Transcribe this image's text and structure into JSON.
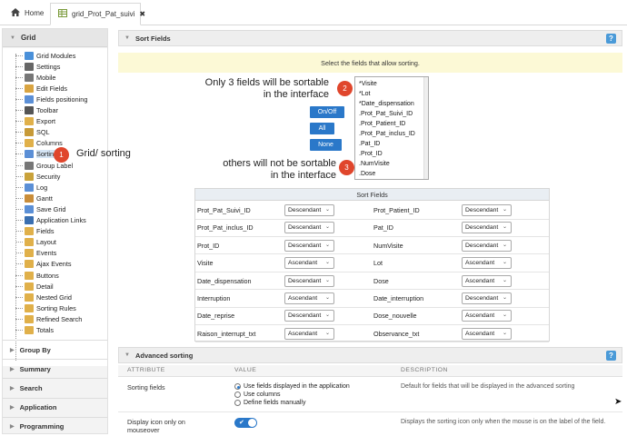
{
  "topbar": {
    "home_label": "Home",
    "grid_tab_label": "grid_Prot_Pat_suivi",
    "close_glyph": "✖"
  },
  "sidebar": {
    "header": "Grid",
    "items": [
      {
        "label": "Grid Modules",
        "icon": "modules-icon",
        "color": "#4a90d9"
      },
      {
        "label": "Settings",
        "icon": "gear-icon",
        "color": "#666666"
      },
      {
        "label": "Mobile",
        "icon": "mobile-icon",
        "color": "#777777"
      },
      {
        "label": "Edit Fields",
        "icon": "edit-icon",
        "color": "#d9a441"
      },
      {
        "label": "Fields positioning",
        "icon": "move-icon",
        "color": "#5b8fd6"
      },
      {
        "label": "Toolbar",
        "icon": "wrench-icon",
        "color": "#555555"
      },
      {
        "label": "Export",
        "icon": "folder-icon",
        "color": "#e0b04a"
      },
      {
        "label": "SQL",
        "icon": "database-icon",
        "color": "#c79a38"
      },
      {
        "label": "Columns",
        "icon": "folder-icon",
        "color": "#e0b04a"
      },
      {
        "label": "Sorting",
        "icon": "sort-icon",
        "color": "#5b8fd6"
      },
      {
        "label": "Group Label",
        "icon": "group-icon",
        "color": "#777777"
      },
      {
        "label": "Security",
        "icon": "lock-icon",
        "color": "#c9a23a"
      },
      {
        "label": "Log",
        "icon": "log-icon",
        "color": "#5b8fd6"
      },
      {
        "label": "Gantt",
        "icon": "gantt-icon",
        "color": "#c98d3a"
      },
      {
        "label": "Save Grid",
        "icon": "save-icon",
        "color": "#5b8fd6"
      },
      {
        "label": "Application Links",
        "icon": "link-icon",
        "color": "#3a6fb0"
      },
      {
        "label": "Fields",
        "icon": "folder-icon",
        "color": "#e0b04a"
      },
      {
        "label": "Layout",
        "icon": "folder-icon",
        "color": "#e0b04a"
      },
      {
        "label": "Events",
        "icon": "folder-icon",
        "color": "#e0b04a"
      },
      {
        "label": "Ajax Events",
        "icon": "folder-icon",
        "color": "#e0b04a"
      },
      {
        "label": "Buttons",
        "icon": "folder-icon",
        "color": "#e0b04a"
      },
      {
        "label": "Detail",
        "icon": "folder-icon",
        "color": "#e0b04a"
      },
      {
        "label": "Nested Grid",
        "icon": "folder-icon",
        "color": "#e0b04a"
      },
      {
        "label": "Sorting Rules",
        "icon": "folder-icon",
        "color": "#e0b04a"
      },
      {
        "label": "Refined Search",
        "icon": "folder-icon",
        "color": "#e0b04a"
      },
      {
        "label": "Totals",
        "icon": "folder-icon",
        "color": "#e0b04a"
      }
    ],
    "sections": [
      "Group By",
      "Summary",
      "Search",
      "Application",
      "Programming"
    ]
  },
  "main": {
    "sort_fields_title": "Sort Fields",
    "help_glyph": "?",
    "info_text": "Select the fields that allow sorting.",
    "annotation_top": "Only 3 fields will be sortable\nin the interface",
    "annotation_bottom": "others will not be sortable\nin the interface",
    "annotation_sidebar": "Grid/ sorting",
    "badge1": "1",
    "badge2": "2",
    "badge3": "3",
    "btn_onoff": "On/Off",
    "btn_all": "All",
    "btn_none": "None",
    "fields_list": [
      "*Visite",
      "*Lot",
      "*Date_dispensation",
      ".Prot_Pat_Suivi_ID",
      ".Prot_Patient_ID",
      ".Prot_Pat_inclus_ID",
      ".Pat_ID",
      ".Prot_ID",
      ".NumVisite",
      ".Dose"
    ],
    "sort_table_title": "Sort Fields",
    "sort_rows": [
      [
        {
          "field": "Prot_Pat_Suivi_ID",
          "order": "Descendant"
        },
        {
          "field": "Prot_Patient_ID",
          "order": "Descendant"
        }
      ],
      [
        {
          "field": "Prot_Pat_inclus_ID",
          "order": "Descendant"
        },
        {
          "field": "Pat_ID",
          "order": "Descendant"
        }
      ],
      [
        {
          "field": "Prot_ID",
          "order": "Descendant"
        },
        {
          "field": "NumVisite",
          "order": "Descendant"
        }
      ],
      [
        {
          "field": "Visite",
          "order": "Ascendant"
        },
        {
          "field": "Lot",
          "order": "Ascendant"
        }
      ],
      [
        {
          "field": "Date_dispensation",
          "order": "Descendant"
        },
        {
          "field": "Dose",
          "order": "Ascendant"
        }
      ],
      [
        {
          "field": "Interruption",
          "order": "Ascendant"
        },
        {
          "field": "Date_interruption",
          "order": "Descendant"
        }
      ],
      [
        {
          "field": "Date_reprise",
          "order": "Descendant"
        },
        {
          "field": "Dose_nouvelle",
          "order": "Ascendant"
        }
      ],
      [
        {
          "field": "Raison_interrupt_txt",
          "order": "Ascendant"
        },
        {
          "field": "Observance_txt",
          "order": "Ascendant"
        }
      ]
    ]
  },
  "advanced": {
    "title": "Advanced sorting",
    "col_attribute": "ATTRIBUTE",
    "col_value": "VALUE",
    "col_description": "DESCRIPTION",
    "row1_attr": "Sorting fields",
    "row1_opts": [
      "Use fields displayed in the application",
      "Use columns",
      "Define fields manually"
    ],
    "row1_desc": "Default for fields that will be displayed in the advanced sorting",
    "row2_attr": "Display icon only on mouseover",
    "row2_desc": "Displays the sorting icon only when the mouse is on the label of the field.",
    "toggle_on": true
  },
  "colors": {
    "accent": "#2a78c9",
    "badge": "#e0462c",
    "info_bg": "#fcf9d6"
  }
}
